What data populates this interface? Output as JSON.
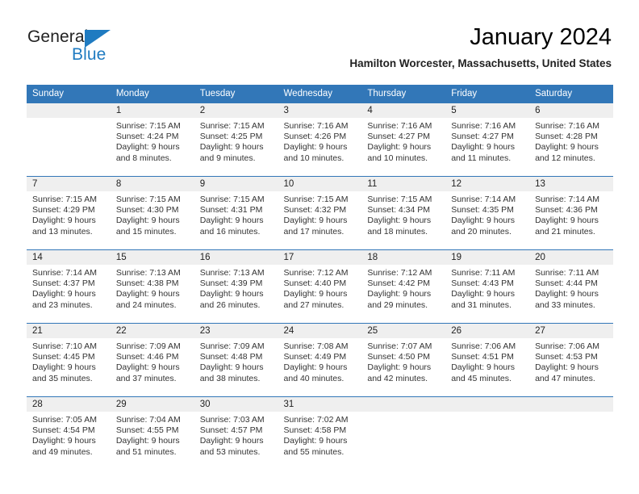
{
  "brand": {
    "name_part1": "General",
    "name_part2": "Blue",
    "accent_color": "#1f7bc1"
  },
  "header": {
    "title": "January 2024",
    "subtitle": "Hamilton Worcester, Massachusetts, United States"
  },
  "theme": {
    "header_bar_color": "#3277b8",
    "daynum_band_color": "#efefef",
    "text_color": "#333333"
  },
  "weekdays": [
    "Sunday",
    "Monday",
    "Tuesday",
    "Wednesday",
    "Thursday",
    "Friday",
    "Saturday"
  ],
  "weeks": [
    [
      {
        "day": "",
        "empty": true
      },
      {
        "day": "1",
        "sunrise": "Sunrise: 7:15 AM",
        "sunset": "Sunset: 4:24 PM",
        "daylight1": "Daylight: 9 hours",
        "daylight2": "and 8 minutes."
      },
      {
        "day": "2",
        "sunrise": "Sunrise: 7:15 AM",
        "sunset": "Sunset: 4:25 PM",
        "daylight1": "Daylight: 9 hours",
        "daylight2": "and 9 minutes."
      },
      {
        "day": "3",
        "sunrise": "Sunrise: 7:16 AM",
        "sunset": "Sunset: 4:26 PM",
        "daylight1": "Daylight: 9 hours",
        "daylight2": "and 10 minutes."
      },
      {
        "day": "4",
        "sunrise": "Sunrise: 7:16 AM",
        "sunset": "Sunset: 4:27 PM",
        "daylight1": "Daylight: 9 hours",
        "daylight2": "and 10 minutes."
      },
      {
        "day": "5",
        "sunrise": "Sunrise: 7:16 AM",
        "sunset": "Sunset: 4:27 PM",
        "daylight1": "Daylight: 9 hours",
        "daylight2": "and 11 minutes."
      },
      {
        "day": "6",
        "sunrise": "Sunrise: 7:16 AM",
        "sunset": "Sunset: 4:28 PM",
        "daylight1": "Daylight: 9 hours",
        "daylight2": "and 12 minutes."
      }
    ],
    [
      {
        "day": "7",
        "sunrise": "Sunrise: 7:15 AM",
        "sunset": "Sunset: 4:29 PM",
        "daylight1": "Daylight: 9 hours",
        "daylight2": "and 13 minutes."
      },
      {
        "day": "8",
        "sunrise": "Sunrise: 7:15 AM",
        "sunset": "Sunset: 4:30 PM",
        "daylight1": "Daylight: 9 hours",
        "daylight2": "and 15 minutes."
      },
      {
        "day": "9",
        "sunrise": "Sunrise: 7:15 AM",
        "sunset": "Sunset: 4:31 PM",
        "daylight1": "Daylight: 9 hours",
        "daylight2": "and 16 minutes."
      },
      {
        "day": "10",
        "sunrise": "Sunrise: 7:15 AM",
        "sunset": "Sunset: 4:32 PM",
        "daylight1": "Daylight: 9 hours",
        "daylight2": "and 17 minutes."
      },
      {
        "day": "11",
        "sunrise": "Sunrise: 7:15 AM",
        "sunset": "Sunset: 4:34 PM",
        "daylight1": "Daylight: 9 hours",
        "daylight2": "and 18 minutes."
      },
      {
        "day": "12",
        "sunrise": "Sunrise: 7:14 AM",
        "sunset": "Sunset: 4:35 PM",
        "daylight1": "Daylight: 9 hours",
        "daylight2": "and 20 minutes."
      },
      {
        "day": "13",
        "sunrise": "Sunrise: 7:14 AM",
        "sunset": "Sunset: 4:36 PM",
        "daylight1": "Daylight: 9 hours",
        "daylight2": "and 21 minutes."
      }
    ],
    [
      {
        "day": "14",
        "sunrise": "Sunrise: 7:14 AM",
        "sunset": "Sunset: 4:37 PM",
        "daylight1": "Daylight: 9 hours",
        "daylight2": "and 23 minutes."
      },
      {
        "day": "15",
        "sunrise": "Sunrise: 7:13 AM",
        "sunset": "Sunset: 4:38 PM",
        "daylight1": "Daylight: 9 hours",
        "daylight2": "and 24 minutes."
      },
      {
        "day": "16",
        "sunrise": "Sunrise: 7:13 AM",
        "sunset": "Sunset: 4:39 PM",
        "daylight1": "Daylight: 9 hours",
        "daylight2": "and 26 minutes."
      },
      {
        "day": "17",
        "sunrise": "Sunrise: 7:12 AM",
        "sunset": "Sunset: 4:40 PM",
        "daylight1": "Daylight: 9 hours",
        "daylight2": "and 27 minutes."
      },
      {
        "day": "18",
        "sunrise": "Sunrise: 7:12 AM",
        "sunset": "Sunset: 4:42 PM",
        "daylight1": "Daylight: 9 hours",
        "daylight2": "and 29 minutes."
      },
      {
        "day": "19",
        "sunrise": "Sunrise: 7:11 AM",
        "sunset": "Sunset: 4:43 PM",
        "daylight1": "Daylight: 9 hours",
        "daylight2": "and 31 minutes."
      },
      {
        "day": "20",
        "sunrise": "Sunrise: 7:11 AM",
        "sunset": "Sunset: 4:44 PM",
        "daylight1": "Daylight: 9 hours",
        "daylight2": "and 33 minutes."
      }
    ],
    [
      {
        "day": "21",
        "sunrise": "Sunrise: 7:10 AM",
        "sunset": "Sunset: 4:45 PM",
        "daylight1": "Daylight: 9 hours",
        "daylight2": "and 35 minutes."
      },
      {
        "day": "22",
        "sunrise": "Sunrise: 7:09 AM",
        "sunset": "Sunset: 4:46 PM",
        "daylight1": "Daylight: 9 hours",
        "daylight2": "and 37 minutes."
      },
      {
        "day": "23",
        "sunrise": "Sunrise: 7:09 AM",
        "sunset": "Sunset: 4:48 PM",
        "daylight1": "Daylight: 9 hours",
        "daylight2": "and 38 minutes."
      },
      {
        "day": "24",
        "sunrise": "Sunrise: 7:08 AM",
        "sunset": "Sunset: 4:49 PM",
        "daylight1": "Daylight: 9 hours",
        "daylight2": "and 40 minutes."
      },
      {
        "day": "25",
        "sunrise": "Sunrise: 7:07 AM",
        "sunset": "Sunset: 4:50 PM",
        "daylight1": "Daylight: 9 hours",
        "daylight2": "and 42 minutes."
      },
      {
        "day": "26",
        "sunrise": "Sunrise: 7:06 AM",
        "sunset": "Sunset: 4:51 PM",
        "daylight1": "Daylight: 9 hours",
        "daylight2": "and 45 minutes."
      },
      {
        "day": "27",
        "sunrise": "Sunrise: 7:06 AM",
        "sunset": "Sunset: 4:53 PM",
        "daylight1": "Daylight: 9 hours",
        "daylight2": "and 47 minutes."
      }
    ],
    [
      {
        "day": "28",
        "sunrise": "Sunrise: 7:05 AM",
        "sunset": "Sunset: 4:54 PM",
        "daylight1": "Daylight: 9 hours",
        "daylight2": "and 49 minutes."
      },
      {
        "day": "29",
        "sunrise": "Sunrise: 7:04 AM",
        "sunset": "Sunset: 4:55 PM",
        "daylight1": "Daylight: 9 hours",
        "daylight2": "and 51 minutes."
      },
      {
        "day": "30",
        "sunrise": "Sunrise: 7:03 AM",
        "sunset": "Sunset: 4:57 PM",
        "daylight1": "Daylight: 9 hours",
        "daylight2": "and 53 minutes."
      },
      {
        "day": "31",
        "sunrise": "Sunrise: 7:02 AM",
        "sunset": "Sunset: 4:58 PM",
        "daylight1": "Daylight: 9 hours",
        "daylight2": "and 55 minutes."
      },
      {
        "day": "",
        "empty": true
      },
      {
        "day": "",
        "empty": true
      },
      {
        "day": "",
        "empty": true
      }
    ]
  ]
}
